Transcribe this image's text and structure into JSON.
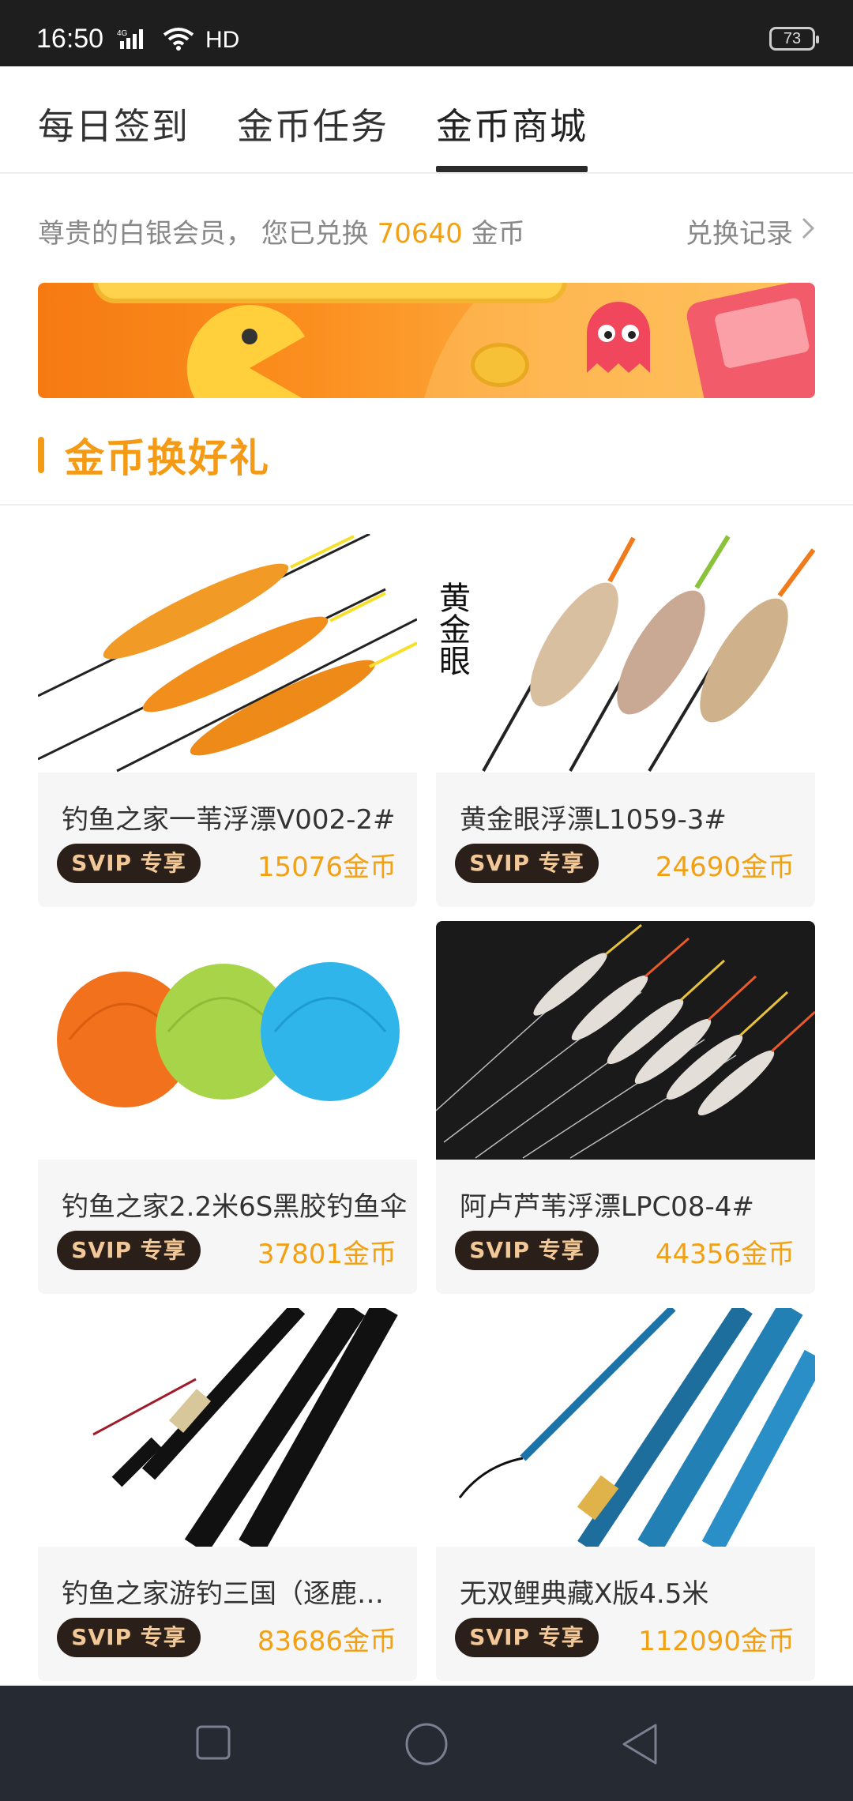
{
  "status_bar": {
    "time": "16:50",
    "network": "4G",
    "hd": "HD",
    "battery": "73"
  },
  "tabs": [
    {
      "label": "每日签到",
      "active": false
    },
    {
      "label": "金币任务",
      "active": false
    },
    {
      "label": "金币商城",
      "active": true
    }
  ],
  "member": {
    "prefix": "尊贵的白银会员，  您已兑换 ",
    "amount": "70640",
    "suffix": " 金币",
    "record_label": "兑换记录"
  },
  "section": {
    "title": "金币换好礼"
  },
  "products": [
    {
      "name": "钓鱼之家一苇浮漂V002-2#",
      "badge": "SVIP 专享",
      "price": "15076金币",
      "image": "orange-fishing-floats"
    },
    {
      "name": "黄金眼浮漂L1059-3#",
      "badge": "SVIP 专享",
      "price": "24690金币",
      "image": "golden-eye-floats",
      "image_text": "黄金眼"
    },
    {
      "name": "钓鱼之家2.2米6S黑胶钓鱼伞",
      "badge": "SVIP 专享",
      "price": "37801金币",
      "image": "fishing-umbrellas"
    },
    {
      "name": "阿卢芦苇浮漂LPC08-4#",
      "badge": "SVIP 专享",
      "price": "44356金币",
      "image": "reed-floats-dark"
    },
    {
      "name": "钓鱼之家游钓三国（逐鹿中原）",
      "badge": "SVIP 专享",
      "price": "83686金币",
      "image": "black-fishing-rod"
    },
    {
      "name": "无双鲤典藏X版4.5米",
      "badge": "SVIP 专享",
      "price": "112090金币",
      "image": "blue-fishing-rod"
    }
  ],
  "colors": {
    "accent": "#f2a014",
    "badge_bg": "#2b2019",
    "badge_text": "#f2c898",
    "nav_bg": "#252a33"
  }
}
